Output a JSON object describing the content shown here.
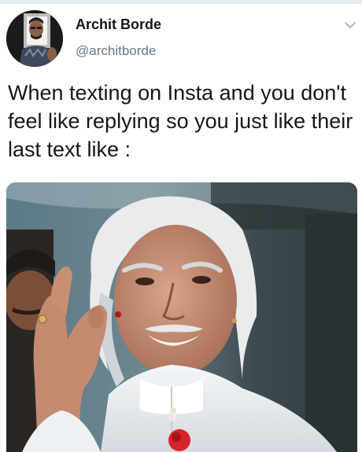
{
  "tweet": {
    "author": {
      "display_name": "Archit Borde",
      "handle": "@architborde"
    },
    "text": "When texting on Insta and you don't feel like replying so you just like their last text like :",
    "menu_icon": "chevron-down-icon"
  },
  "media": {
    "type": "photo"
  },
  "colors": {
    "primary_text": "#14171a",
    "secondary_text": "#657786",
    "chevron": "#aab8c2"
  }
}
